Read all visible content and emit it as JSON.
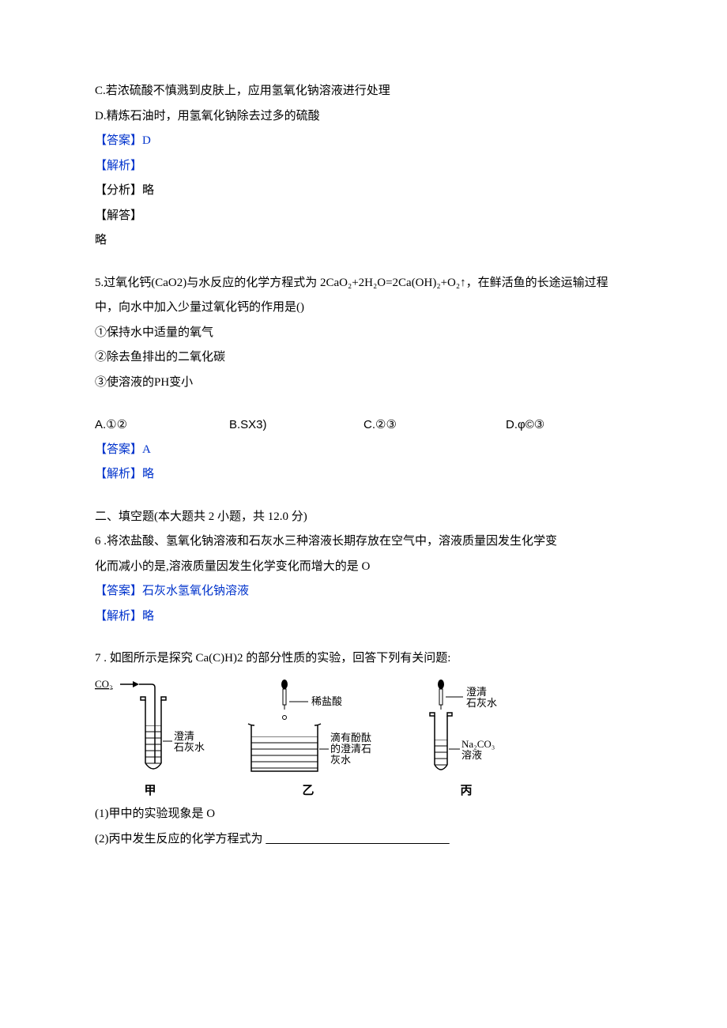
{
  "q4": {
    "optC": "C.若浓硫酸不慎溅到皮肤上，应用氢氧化钠溶液进行处理",
    "optD": "D.精炼石油时，用氢氧化钠除去过多的硫酸",
    "ansLabel": "【答案】D",
    "expLabel": "【解析】",
    "analysis": "【分析】略",
    "solve": "【解答】",
    "none": "略"
  },
  "q5": {
    "stem1": "5.过氧化钙(CaO2)与水反应的化学方程式为 2CaO₂+2H₂O=2Ca(OH)₂+O₂↑，在鲜活鱼的长途运输过程",
    "stem2": "中，向水中加入少量过氧化钙的作用是()",
    "i1": "①保持水中适量的氧气",
    "i2": "②除去鱼排出的二氧化碳",
    "i3": "③使溶液的PH变小",
    "optA": "A.①②",
    "optB": "B.SX3)",
    "optC": "C.②③",
    "optD": "D.φ©③",
    "ansLabel": "【答案】A",
    "expLabel": "【解析】略"
  },
  "section2": "二、填空题(本大题共 2 小题，共 12.0 分)",
  "q6": {
    "stem1": "6  .将浓盐酸、氢氧化钠溶液和石灰水三种溶液长期存放在空气中，溶液质量因发生化学变",
    "stem2": "化而减小的是,溶液质量因发生化学变化而增大的是 O",
    "ansLabel": "【答案】石灰水氢氧化钠溶液",
    "expLabel": "【解析】略"
  },
  "q7": {
    "stem": "7  . 如图所示是探究 Ca(C)H)2 的部分性质的实验，回答下列有关问题:",
    "sub1": "(1)甲中的实验现象是 O",
    "sub2a": "(2)丙中发生反应的化学方程式为 ",
    "sub2b": "                                                              "
  },
  "diagram": {
    "co2": "CO₂",
    "labelA1": "澄清",
    "labelA2": "石灰水",
    "capA": "甲",
    "labelB_acid": "稀盐酸",
    "labelB1": "滴有酚酞",
    "labelB2": "的澄清石",
    "labelB3": "灰水",
    "capB": "乙",
    "labelC1": "澄清",
    "labelC2": "石灰水",
    "labelC3": "Na₂CO₃",
    "labelC4": "溶液",
    "capC": "丙"
  }
}
